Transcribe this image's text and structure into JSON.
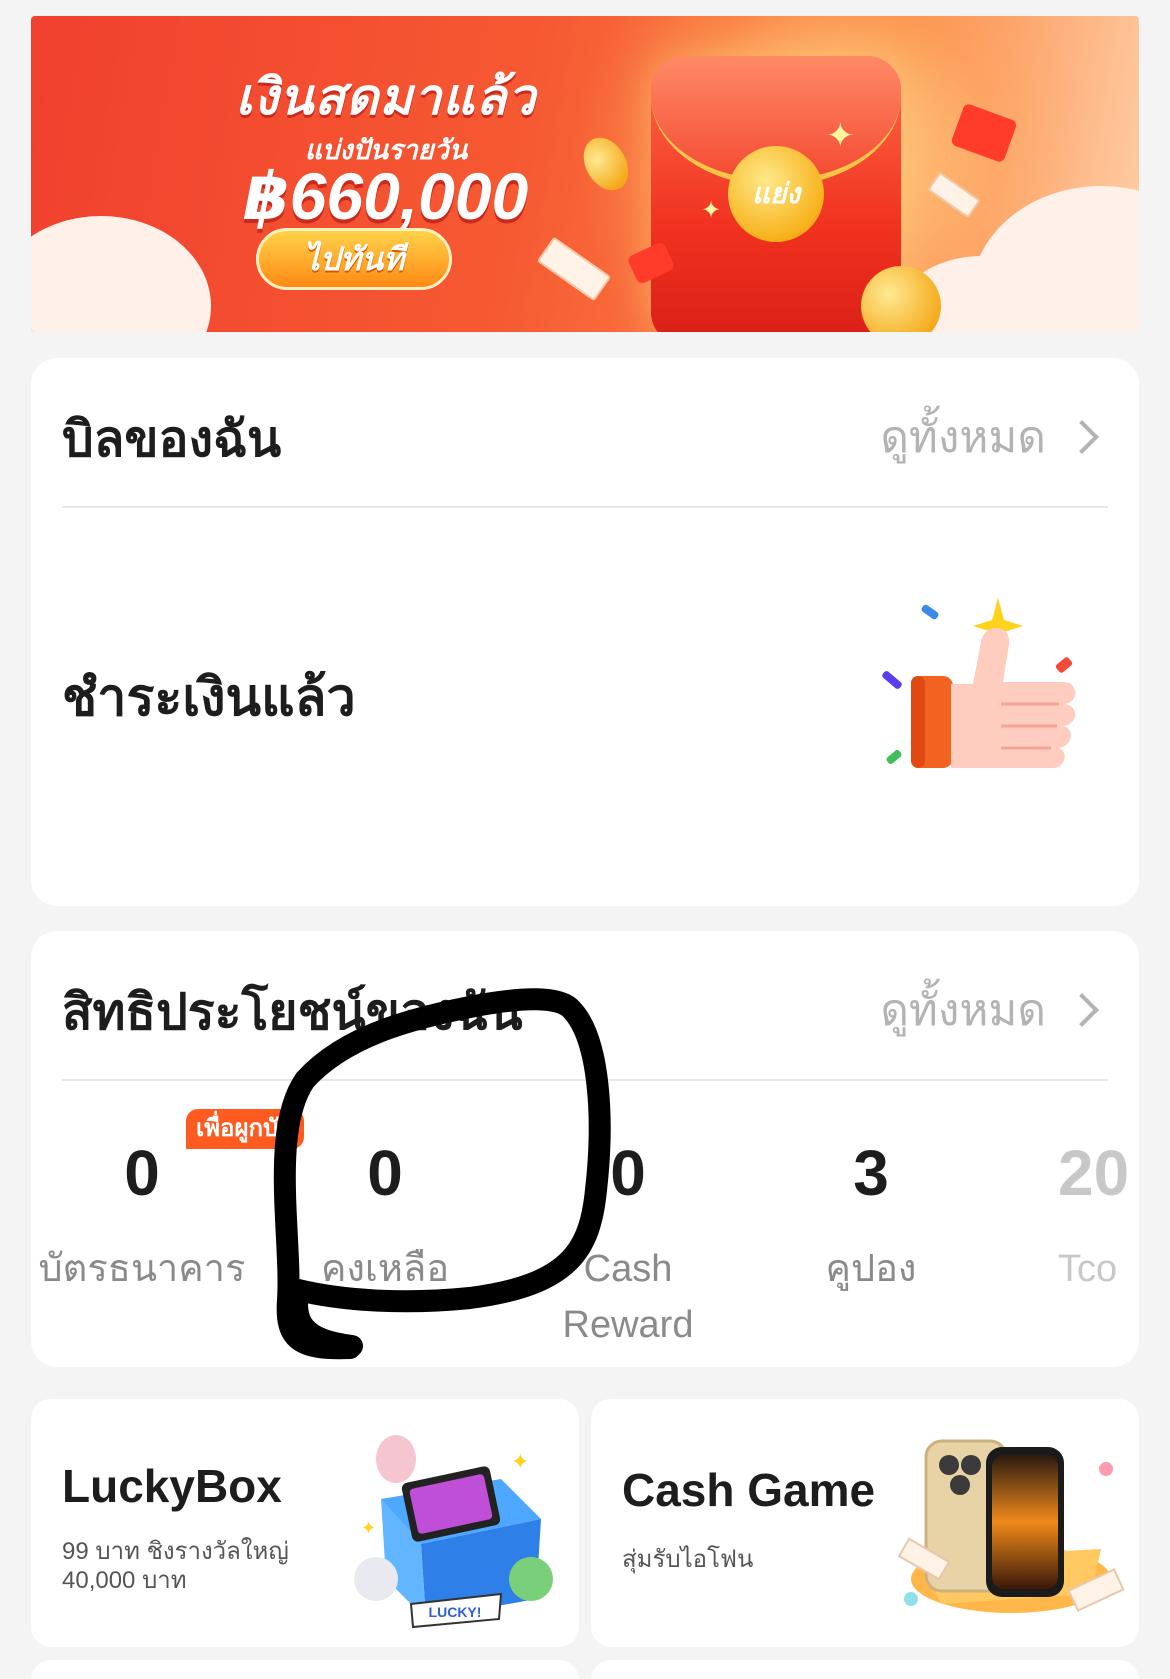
{
  "banner": {
    "title": "เงินสดมาแล้ว",
    "subtitle": "แบ่งปันรายวัน",
    "amount": "฿660,000",
    "button_label": "ไปทันที",
    "seal_label": "แย่ง"
  },
  "bill": {
    "title": "บิลของฉัน",
    "view_all": "ดูทั้งหมด",
    "status": "ชำระเงินแล้ว"
  },
  "benefits": {
    "title": "สิทธิประโยชน์ของฉัน",
    "view_all": "ดูทั้งหมด",
    "bank_tag": "เพื่อผูกบัต",
    "items": [
      {
        "value": "0",
        "label": "บัตรธนาคาร"
      },
      {
        "value": "0",
        "label": "คงเหลือ"
      },
      {
        "value": "0",
        "label": "Cash Reward"
      },
      {
        "value": "3",
        "label": "คูปอง"
      },
      {
        "value": "20",
        "label": "Tco"
      }
    ]
  },
  "promos": [
    {
      "title": "LuckyBox",
      "desc": "99 บาท ชิงรางวัลใหญ่ 40,000 บาท",
      "art_text": "LUCKY!"
    },
    {
      "title": "Cash Game",
      "desc": "สุ่มรับไอโฟน"
    }
  ],
  "colors": {
    "accent": "#ff5a1f",
    "banner_red": "#f0402e",
    "annotation": "#000000"
  }
}
